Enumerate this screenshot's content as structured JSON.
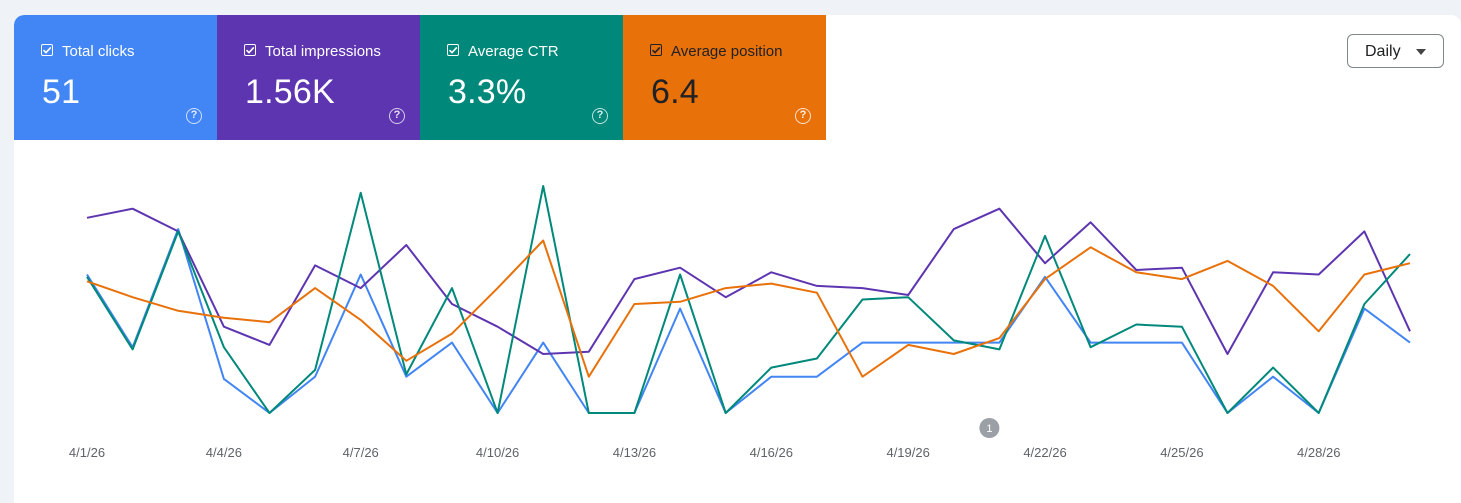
{
  "metrics": [
    {
      "label": "Total clicks",
      "value": "51",
      "color": "#4285f4"
    },
    {
      "label": "Total impressions",
      "value": "1.56K",
      "color": "#5e35b1"
    },
    {
      "label": "Average CTR",
      "value": "3.3%",
      "color": "#00897b"
    },
    {
      "label": "Average position",
      "value": "6.4",
      "color": "#e8710a"
    }
  ],
  "period_select": {
    "value": "Daily",
    "icon": "caret-down-icon"
  },
  "help_icon": "help-circle-icon",
  "checkbox_icon": "checkbox-checked-icon",
  "chart_data": {
    "type": "line",
    "x": [
      "4/1/26",
      "4/2/26",
      "4/3/26",
      "4/4/26",
      "4/5/26",
      "4/6/26",
      "4/7/26",
      "4/8/26",
      "4/9/26",
      "4/10/26",
      "4/11/26",
      "4/12/26",
      "4/13/26",
      "4/14/26",
      "4/15/26",
      "4/16/26",
      "4/17/26",
      "4/18/26",
      "4/19/26",
      "4/20/26",
      "4/21/26",
      "4/22/26",
      "4/23/26",
      "4/24/26",
      "4/25/26",
      "4/26/26",
      "4/27/26",
      "4/28/26",
      "4/29/26",
      "4/30/26"
    ],
    "tick_labels": [
      "4/1/26",
      "4/4/26",
      "4/7/26",
      "4/10/26",
      "4/13/26",
      "4/16/26",
      "4/19/26",
      "4/22/26",
      "4/25/26",
      "4/28/26"
    ],
    "annotation": {
      "text": "1",
      "x": "4/21/26"
    },
    "grid": false,
    "legend": "none",
    "series": [
      {
        "name": "Total clicks",
        "color": "#4285f4",
        "values": [
          0.61,
          0.29,
          0.81,
          0.15,
          0,
          0.16,
          0.61,
          0.16,
          0.31,
          0,
          0.31,
          0,
          0,
          0.46,
          0,
          0.16,
          0.16,
          0.31,
          0.31,
          0.31,
          0.31,
          0.6,
          0.31,
          0.31,
          0.31,
          0,
          0.16,
          0,
          0.46,
          0.31
        ]
      },
      {
        "name": "Total impressions",
        "color": "#5e35b1",
        "values": [
          0.86,
          0.9,
          0.8,
          0.38,
          0.3,
          0.65,
          0.55,
          0.74,
          0.48,
          0.38,
          0.26,
          0.27,
          0.59,
          0.64,
          0.51,
          0.62,
          0.56,
          0.55,
          0.52,
          0.81,
          0.9,
          0.66,
          0.84,
          0.63,
          0.64,
          0.26,
          0.62,
          0.61,
          0.8,
          0.36
        ]
      },
      {
        "name": "Average CTR",
        "color": "#00897b",
        "values": [
          0.6,
          0.28,
          0.8,
          0.29,
          0,
          0.19,
          0.97,
          0.17,
          0.55,
          0,
          1.0,
          0,
          0,
          0.61,
          0,
          0.2,
          0.24,
          0.5,
          0.51,
          0.32,
          0.28,
          0.78,
          0.29,
          0.39,
          0.38,
          0,
          0.2,
          0,
          0.48,
          0.7
        ]
      },
      {
        "name": "Average position",
        "color": "#e8710a",
        "values": [
          0.58,
          0.51,
          0.45,
          0.42,
          0.4,
          0.55,
          0.41,
          0.23,
          0.35,
          0.55,
          0.76,
          0.16,
          0.48,
          0.49,
          0.55,
          0.57,
          0.53,
          0.16,
          0.3,
          0.26,
          0.33,
          0.59,
          0.73,
          0.62,
          0.59,
          0.67,
          0.56,
          0.36,
          0.61,
          0.66
        ]
      }
    ]
  }
}
